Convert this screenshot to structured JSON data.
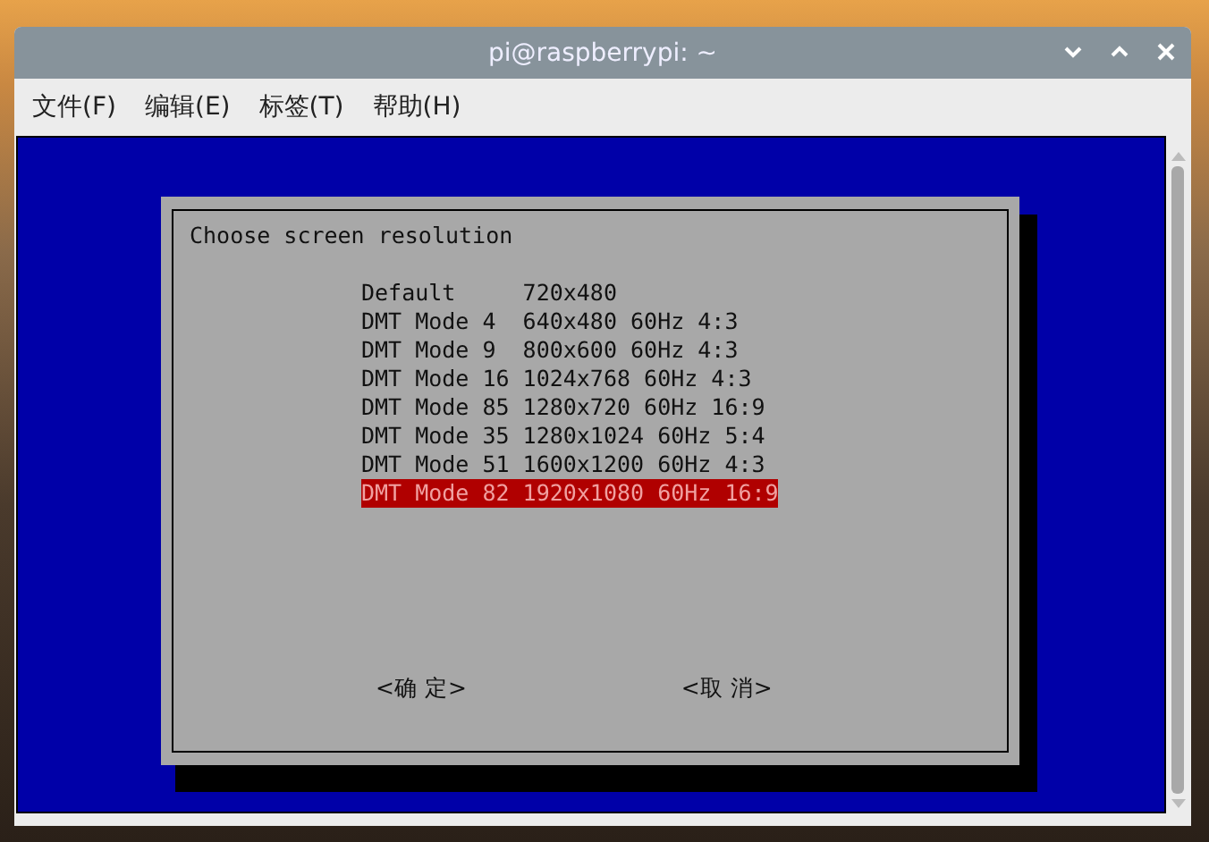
{
  "window": {
    "title": "pi@raspberrypi: ~"
  },
  "menu": [
    "文件(F)",
    "编辑(E)",
    "标签(T)",
    "帮助(H)"
  ],
  "dialog": {
    "title": "Choose screen resolution",
    "options": [
      {
        "label": "Default     720x480",
        "selected": false
      },
      {
        "label": "DMT Mode 4  640x480 60Hz 4:3",
        "selected": false
      },
      {
        "label": "DMT Mode 9  800x600 60Hz 4:3",
        "selected": false
      },
      {
        "label": "DMT Mode 16 1024x768 60Hz 4:3",
        "selected": false
      },
      {
        "label": "DMT Mode 85 1280x720 60Hz 16:9",
        "selected": false
      },
      {
        "label": "DMT Mode 35 1280x1024 60Hz 5:4",
        "selected": false
      },
      {
        "label": "DMT Mode 51 1600x1200 60Hz 4:3",
        "selected": false
      },
      {
        "label": "DMT Mode 82 1920x1080 60Hz 16:9",
        "selected": true
      }
    ],
    "buttons": [
      "<确 定>",
      "<取 消>"
    ]
  }
}
